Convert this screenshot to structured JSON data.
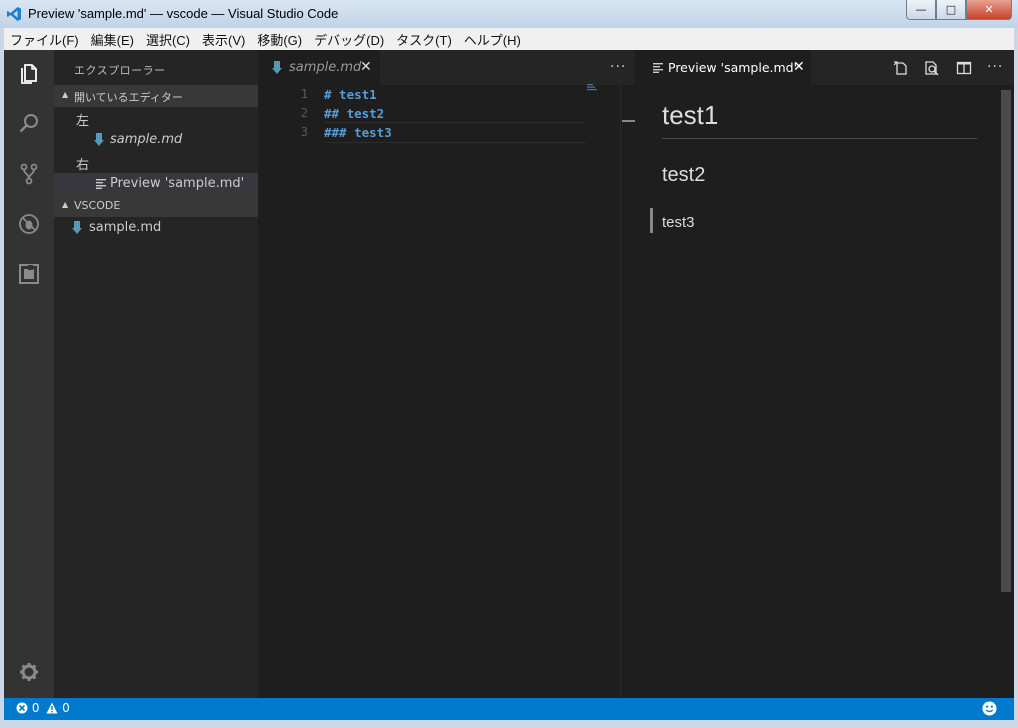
{
  "window": {
    "title": "Preview 'sample.md' — vscode — Visual Studio Code",
    "min_glyph": "—",
    "max_glyph": "□",
    "close_glyph": "✕"
  },
  "menubar": {
    "items": [
      {
        "label": "ファイル(F)"
      },
      {
        "label": "編集(E)"
      },
      {
        "label": "選択(C)"
      },
      {
        "label": "表示(V)"
      },
      {
        "label": "移動(G)"
      },
      {
        "label": "デバッグ(D)"
      },
      {
        "label": "タスク(T)"
      },
      {
        "label": "ヘルプ(H)"
      }
    ]
  },
  "activity_bar": {
    "icons": [
      "files-icon",
      "search-icon",
      "source-control-icon",
      "debug-icon",
      "extensions-icon"
    ],
    "bottom_icon": "gear-icon"
  },
  "sidebar": {
    "title": "エクスプローラー",
    "open_editors": {
      "label": "開いているエディター",
      "groups": [
        {
          "label": "左",
          "files": [
            {
              "name": "sample.md",
              "icon": "markdown-icon"
            }
          ]
        },
        {
          "label": "右",
          "files": [
            {
              "name": "Preview 'sample.md'",
              "icon": "preview-icon"
            }
          ]
        }
      ]
    },
    "workspace": {
      "label": "VSCODE",
      "files": [
        {
          "name": "sample.md",
          "icon": "markdown-icon"
        }
      ]
    }
  },
  "editor": {
    "tab": {
      "label": "sample.md",
      "close_glyph": "✕"
    },
    "more_glyph": "···",
    "lines": [
      {
        "num": "1",
        "text": "# test1"
      },
      {
        "num": "2",
        "text": "## test2"
      },
      {
        "num": "3",
        "text": "### test3"
      }
    ]
  },
  "preview": {
    "tab": {
      "label": "Preview 'sample.md'",
      "close_glyph": "✕"
    },
    "more_glyph": "···",
    "toolbar_icons": [
      "open-source-icon",
      "open-preview-icon",
      "split-editor-icon"
    ],
    "h1": "test1",
    "h2": "test2",
    "h3": "test3"
  },
  "statusbar": {
    "errors": "0",
    "warnings": "0",
    "feedback_icon": "smiley-icon"
  },
  "colors": {
    "accent": "#007acc",
    "markdown_blue": "#569cd6",
    "md_file_icon": "#519aba"
  }
}
